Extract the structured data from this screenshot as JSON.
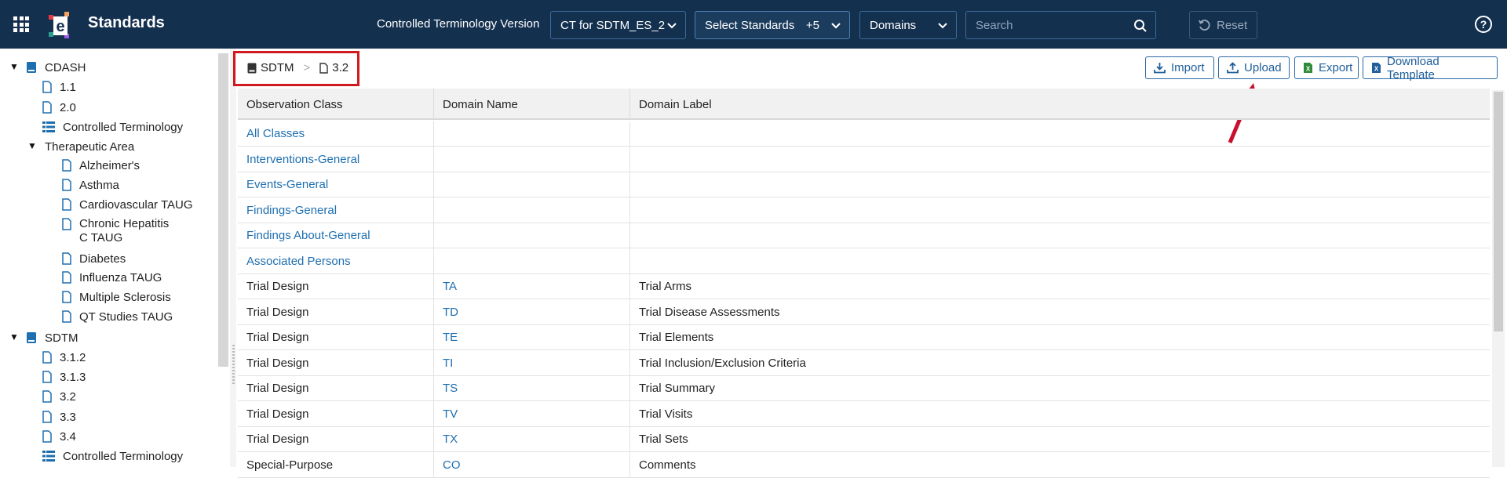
{
  "header": {
    "app_title": "Standards",
    "ct_label": "Controlled Terminology Version",
    "ct_select_value": "CT for SDTM_ES_2",
    "standards_select_value": "Select Standards",
    "standards_extra": "+5",
    "domains_select_value": "Domains",
    "search_placeholder": "Search",
    "reset_label": "Reset"
  },
  "sidebar": {
    "cdash": "CDASH",
    "cdash_items": [
      "1.1",
      "2.0",
      "Controlled Terminology"
    ],
    "therapeutic_area": "Therapeutic Area",
    "ta_items": [
      "Alzheimer's",
      "Asthma",
      "Cardiovascular TAUG",
      "Chronic Hepatitis C TAUG",
      "Diabetes",
      "Influenza TAUG",
      "Multiple Sclerosis",
      "QT Studies TAUG"
    ],
    "sdtm": "SDTM",
    "sdtm_items": [
      "3.1.2",
      "3.1.3",
      "3.2",
      "3.3",
      "3.4",
      "Controlled Terminology"
    ]
  },
  "breadcrumb": {
    "root": "SDTM",
    "separator": ">",
    "current": "3.2"
  },
  "actions": {
    "import": "Import",
    "upload": "Upload",
    "export": "Export",
    "download_template": "Download Template"
  },
  "table": {
    "headers": [
      "Observation Class",
      "Domain Name",
      "Domain Label"
    ],
    "rows": [
      [
        "All Classes",
        "",
        ""
      ],
      [
        "Interventions-General",
        "",
        ""
      ],
      [
        "Events-General",
        "",
        ""
      ],
      [
        "Findings-General",
        "",
        ""
      ],
      [
        "Findings About-General",
        "",
        ""
      ],
      [
        "Associated Persons",
        "",
        ""
      ],
      [
        "Trial Design",
        "TA",
        "Trial Arms"
      ],
      [
        "Trial Design",
        "TD",
        "Trial Disease Assessments"
      ],
      [
        "Trial Design",
        "TE",
        "Trial Elements"
      ],
      [
        "Trial Design",
        "TI",
        "Trial Inclusion/Exclusion Criteria"
      ],
      [
        "Trial Design",
        "TS",
        "Trial Summary"
      ],
      [
        "Trial Design",
        "TV",
        "Trial Visits"
      ],
      [
        "Trial Design",
        "TX",
        "Trial Sets"
      ],
      [
        "Special-Purpose",
        "CO",
        "Comments"
      ]
    ]
  },
  "colors": {
    "topbar": "#14304f",
    "link": "#1e6fb0",
    "highlight": "#d01a1f"
  }
}
